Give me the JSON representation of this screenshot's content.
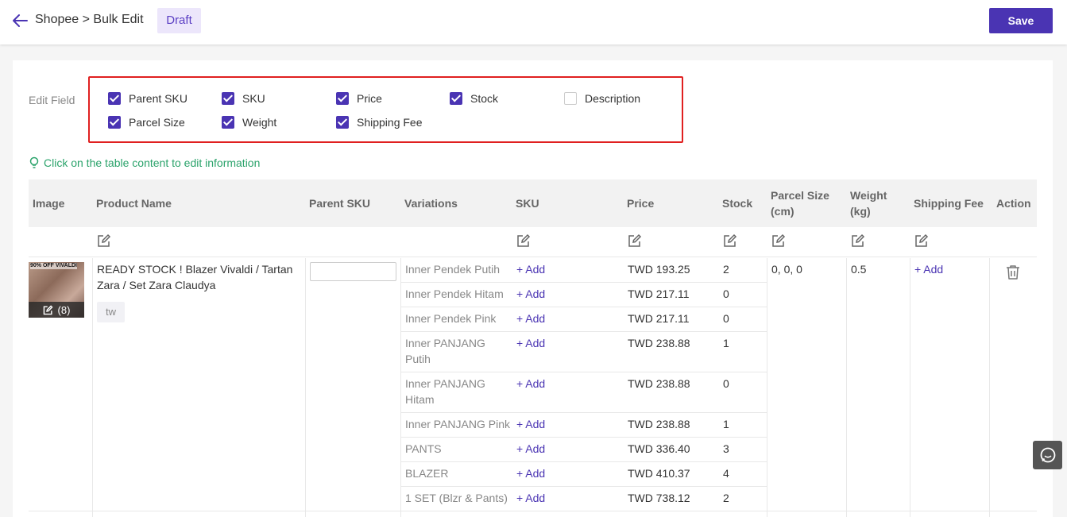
{
  "header": {
    "breadcrumb": "Shopee > Bulk Edit",
    "status": "Draft",
    "save_label": "Save"
  },
  "edit_field": {
    "label": "Edit Field",
    "options": [
      {
        "label": "Parent SKU",
        "checked": true
      },
      {
        "label": "SKU",
        "checked": true
      },
      {
        "label": "Price",
        "checked": true
      },
      {
        "label": "Stock",
        "checked": true
      },
      {
        "label": "Description",
        "checked": false
      },
      {
        "label": "Parcel Size",
        "checked": true
      },
      {
        "label": "Weight",
        "checked": true
      },
      {
        "label": "Shipping Fee",
        "checked": true
      }
    ]
  },
  "tip": "Click on the table content to edit information",
  "table": {
    "headers": {
      "image": "Image",
      "product_name": "Product Name",
      "parent_sku": "Parent SKU",
      "variations": "Variations",
      "sku": "SKU",
      "price": "Price",
      "stock": "Stock",
      "parcel_size_1": "Parcel Size",
      "parcel_size_2": "(cm)",
      "weight_1": "Weight",
      "weight_2": "(kg)",
      "shipping_fee": "Shipping Fee",
      "action": "Action"
    },
    "product": {
      "name_line1": "READY STOCK ! Blazer Vivaldi / Tartan",
      "name_line2": "Zara / Set Zara Claudya",
      "tag": "tw",
      "image_count": "(8)",
      "image_caption": "90% OFF VIVALDI",
      "parcel_size": "0,  0,  0",
      "weight": "0.5",
      "shipping_fee_add": "+ Add"
    },
    "variations": [
      {
        "name1": "Inner Pendek Putih",
        "name2": "",
        "sku": "+ Add",
        "price": "TWD 193.25",
        "stock": "2"
      },
      {
        "name1": "Inner Pendek Hitam",
        "name2": "",
        "sku": "+ Add",
        "price": "TWD 217.11",
        "stock": "0"
      },
      {
        "name1": "Inner Pendek Pink",
        "name2": "",
        "sku": "+ Add",
        "price": "TWD 217.11",
        "stock": "0"
      },
      {
        "name1": "Inner PANJANG",
        "name2": "Putih",
        "sku": "+ Add",
        "price": "TWD 238.88",
        "stock": "1"
      },
      {
        "name1": "Inner PANJANG",
        "name2": "Hitam",
        "sku": "+ Add",
        "price": "TWD 238.88",
        "stock": "0"
      },
      {
        "name1": "Inner PANJANG Pink",
        "name2": "",
        "sku": "+ Add",
        "price": "TWD 238.88",
        "stock": "1"
      },
      {
        "name1": "PANTS",
        "name2": "",
        "sku": "+ Add",
        "price": "TWD 336.40",
        "stock": "3"
      },
      {
        "name1": "BLAZER",
        "name2": "",
        "sku": "+ Add",
        "price": "TWD 410.37",
        "stock": "4"
      },
      {
        "name1": "1 SET (Blzr & Pants)",
        "name2": "",
        "sku": "+ Add",
        "price": "TWD 738.12",
        "stock": "2"
      }
    ]
  }
}
